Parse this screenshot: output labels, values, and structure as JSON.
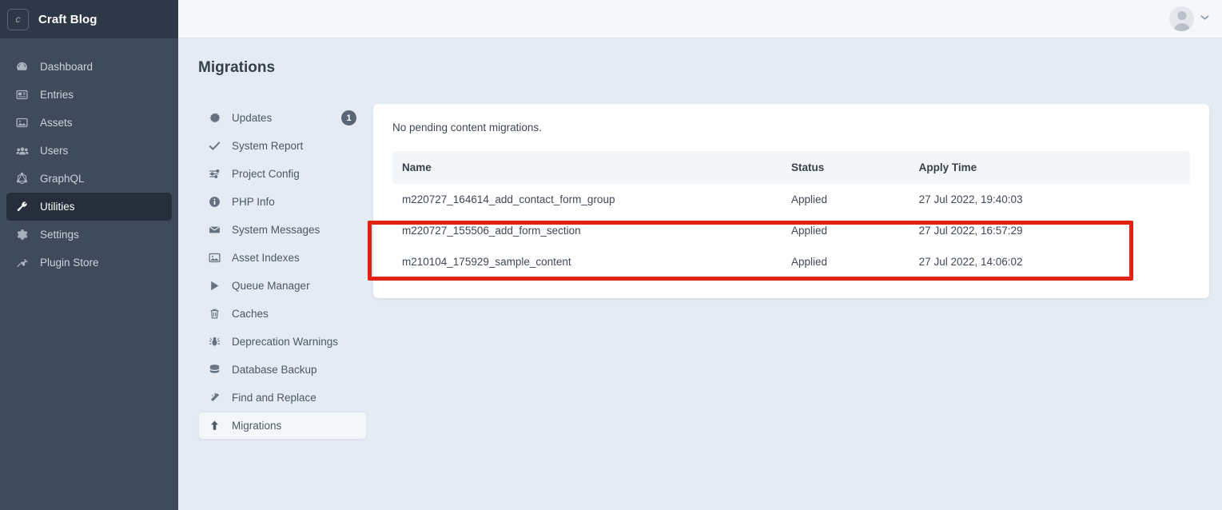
{
  "brand": {
    "mark": "c",
    "name": "Craft Blog"
  },
  "globalnav": {
    "items": [
      {
        "label": "Dashboard",
        "icon": "gauge-icon",
        "active": false
      },
      {
        "label": "Entries",
        "icon": "newspaper-icon",
        "active": false
      },
      {
        "label": "Assets",
        "icon": "image-icon",
        "active": false
      },
      {
        "label": "Users",
        "icon": "users-icon",
        "active": false
      },
      {
        "label": "GraphQL",
        "icon": "graphql-icon",
        "active": false
      },
      {
        "label": "Utilities",
        "icon": "wrench-icon",
        "active": true
      },
      {
        "label": "Settings",
        "icon": "gear-icon",
        "active": false
      },
      {
        "label": "Plugin Store",
        "icon": "plug-icon",
        "active": false
      }
    ]
  },
  "topbar": {
    "avatar": "user-avatar",
    "chevron": "⌄"
  },
  "page": {
    "title": "Migrations"
  },
  "subnav": {
    "items": [
      {
        "label": "Updates",
        "icon": "updates-badge-icon",
        "badge": "1",
        "active": false
      },
      {
        "label": "System Report",
        "icon": "check-icon",
        "badge": null,
        "active": false
      },
      {
        "label": "Project Config",
        "icon": "sliders-icon",
        "badge": null,
        "active": false
      },
      {
        "label": "PHP Info",
        "icon": "info-icon",
        "badge": null,
        "active": false
      },
      {
        "label": "System Messages",
        "icon": "envelope-icon",
        "badge": null,
        "active": false
      },
      {
        "label": "Asset Indexes",
        "icon": "image-icon",
        "badge": null,
        "active": false
      },
      {
        "label": "Queue Manager",
        "icon": "play-icon",
        "badge": null,
        "active": false
      },
      {
        "label": "Caches",
        "icon": "trash-icon",
        "badge": null,
        "active": false
      },
      {
        "label": "Deprecation Warnings",
        "icon": "bug-icon",
        "badge": null,
        "active": false
      },
      {
        "label": "Database Backup",
        "icon": "database-icon",
        "badge": null,
        "active": false
      },
      {
        "label": "Find and Replace",
        "icon": "magic-wand-icon",
        "badge": null,
        "active": false
      },
      {
        "label": "Migrations",
        "icon": "upload-arrow-icon",
        "badge": null,
        "active": true
      }
    ]
  },
  "main": {
    "notice": "No pending content migrations.",
    "table": {
      "headers": [
        "Name",
        "Status",
        "Apply Time"
      ],
      "rows": [
        {
          "name": "m220727_164614_add_contact_form_group",
          "status": "Applied",
          "apply_time": "27 Jul 2022, 19:40:03"
        },
        {
          "name": "m220727_155506_add_form_section",
          "status": "Applied",
          "apply_time": "27 Jul 2022, 16:57:29"
        },
        {
          "name": "m210104_175929_sample_content",
          "status": "Applied",
          "apply_time": "27 Jul 2022, 14:06:02"
        }
      ]
    }
  },
  "annotation": {
    "color": "#e0220f",
    "highlights_rows": [
      1,
      2
    ]
  }
}
